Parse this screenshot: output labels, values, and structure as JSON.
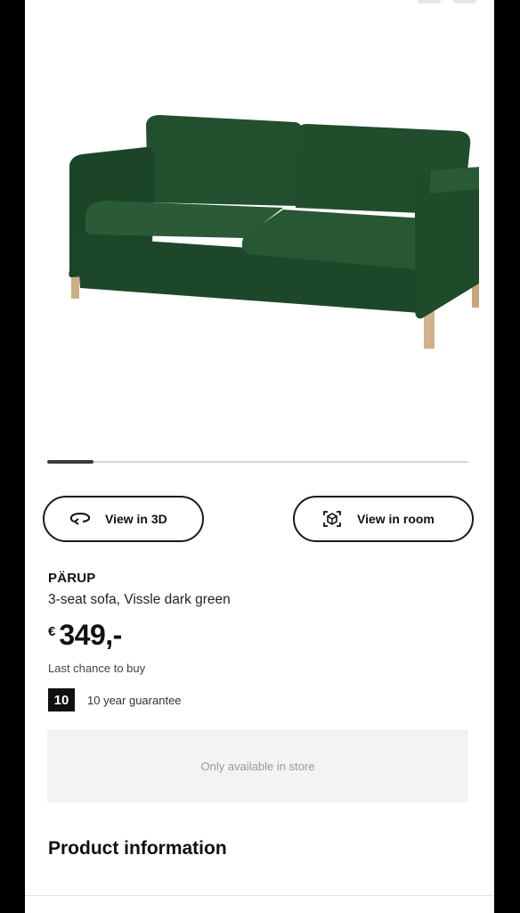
{
  "buttons": {
    "view_3d": "View in 3D",
    "view_room": "View in room"
  },
  "product": {
    "name": "PÄRUP",
    "description": "3-seat sofa, Vissle dark green",
    "currency": "€",
    "price": "349,-",
    "last_chance": "Last chance to buy",
    "guarantee_years": "10",
    "guarantee_text": "10 year guarantee",
    "availability": "Only available in store"
  },
  "sections": {
    "product_information": "Product information"
  },
  "carousel": {
    "position_fraction": 0.11
  },
  "colors": {
    "sofa": "#1f4a2b",
    "accent": "#111111",
    "availability_bg": "#f3f3f3"
  },
  "icons": {
    "view_3d": "rotate-3d-icon",
    "view_room": "ar-cube-icon"
  }
}
